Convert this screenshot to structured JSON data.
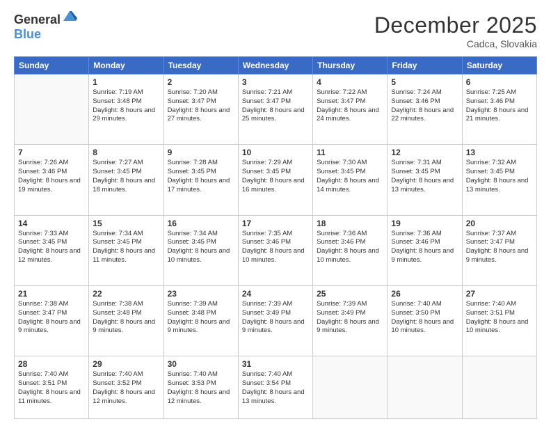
{
  "logo": {
    "general": "General",
    "blue": "Blue"
  },
  "header": {
    "month": "December 2025",
    "location": "Cadca, Slovakia"
  },
  "days": [
    "Sunday",
    "Monday",
    "Tuesday",
    "Wednesday",
    "Thursday",
    "Friday",
    "Saturday"
  ],
  "weeks": [
    [
      {
        "day": "",
        "empty": true
      },
      {
        "day": "1",
        "sunrise": "7:19 AM",
        "sunset": "3:48 PM",
        "daylight": "8 hours and 29 minutes."
      },
      {
        "day": "2",
        "sunrise": "7:20 AM",
        "sunset": "3:47 PM",
        "daylight": "8 hours and 27 minutes."
      },
      {
        "day": "3",
        "sunrise": "7:21 AM",
        "sunset": "3:47 PM",
        "daylight": "8 hours and 25 minutes."
      },
      {
        "day": "4",
        "sunrise": "7:22 AM",
        "sunset": "3:47 PM",
        "daylight": "8 hours and 24 minutes."
      },
      {
        "day": "5",
        "sunrise": "7:24 AM",
        "sunset": "3:46 PM",
        "daylight": "8 hours and 22 minutes."
      },
      {
        "day": "6",
        "sunrise": "7:25 AM",
        "sunset": "3:46 PM",
        "daylight": "8 hours and 21 minutes."
      }
    ],
    [
      {
        "day": "7",
        "sunrise": "7:26 AM",
        "sunset": "3:46 PM",
        "daylight": "8 hours and 19 minutes."
      },
      {
        "day": "8",
        "sunrise": "7:27 AM",
        "sunset": "3:45 PM",
        "daylight": "8 hours and 18 minutes."
      },
      {
        "day": "9",
        "sunrise": "7:28 AM",
        "sunset": "3:45 PM",
        "daylight": "8 hours and 17 minutes."
      },
      {
        "day": "10",
        "sunrise": "7:29 AM",
        "sunset": "3:45 PM",
        "daylight": "8 hours and 16 minutes."
      },
      {
        "day": "11",
        "sunrise": "7:30 AM",
        "sunset": "3:45 PM",
        "daylight": "8 hours and 14 minutes."
      },
      {
        "day": "12",
        "sunrise": "7:31 AM",
        "sunset": "3:45 PM",
        "daylight": "8 hours and 13 minutes."
      },
      {
        "day": "13",
        "sunrise": "7:32 AM",
        "sunset": "3:45 PM",
        "daylight": "8 hours and 13 minutes."
      }
    ],
    [
      {
        "day": "14",
        "sunrise": "7:33 AM",
        "sunset": "3:45 PM",
        "daylight": "8 hours and 12 minutes."
      },
      {
        "day": "15",
        "sunrise": "7:34 AM",
        "sunset": "3:45 PM",
        "daylight": "8 hours and 11 minutes."
      },
      {
        "day": "16",
        "sunrise": "7:34 AM",
        "sunset": "3:45 PM",
        "daylight": "8 hours and 10 minutes."
      },
      {
        "day": "17",
        "sunrise": "7:35 AM",
        "sunset": "3:46 PM",
        "daylight": "8 hours and 10 minutes."
      },
      {
        "day": "18",
        "sunrise": "7:36 AM",
        "sunset": "3:46 PM",
        "daylight": "8 hours and 10 minutes."
      },
      {
        "day": "19",
        "sunrise": "7:36 AM",
        "sunset": "3:46 PM",
        "daylight": "8 hours and 9 minutes."
      },
      {
        "day": "20",
        "sunrise": "7:37 AM",
        "sunset": "3:47 PM",
        "daylight": "8 hours and 9 minutes."
      }
    ],
    [
      {
        "day": "21",
        "sunrise": "7:38 AM",
        "sunset": "3:47 PM",
        "daylight": "8 hours and 9 minutes."
      },
      {
        "day": "22",
        "sunrise": "7:38 AM",
        "sunset": "3:48 PM",
        "daylight": "8 hours and 9 minutes."
      },
      {
        "day": "23",
        "sunrise": "7:39 AM",
        "sunset": "3:48 PM",
        "daylight": "8 hours and 9 minutes."
      },
      {
        "day": "24",
        "sunrise": "7:39 AM",
        "sunset": "3:49 PM",
        "daylight": "8 hours and 9 minutes."
      },
      {
        "day": "25",
        "sunrise": "7:39 AM",
        "sunset": "3:49 PM",
        "daylight": "8 hours and 9 minutes."
      },
      {
        "day": "26",
        "sunrise": "7:40 AM",
        "sunset": "3:50 PM",
        "daylight": "8 hours and 10 minutes."
      },
      {
        "day": "27",
        "sunrise": "7:40 AM",
        "sunset": "3:51 PM",
        "daylight": "8 hours and 10 minutes."
      }
    ],
    [
      {
        "day": "28",
        "sunrise": "7:40 AM",
        "sunset": "3:51 PM",
        "daylight": "8 hours and 11 minutes."
      },
      {
        "day": "29",
        "sunrise": "7:40 AM",
        "sunset": "3:52 PM",
        "daylight": "8 hours and 12 minutes."
      },
      {
        "day": "30",
        "sunrise": "7:40 AM",
        "sunset": "3:53 PM",
        "daylight": "8 hours and 12 minutes."
      },
      {
        "day": "31",
        "sunrise": "7:40 AM",
        "sunset": "3:54 PM",
        "daylight": "8 hours and 13 minutes."
      },
      {
        "day": "",
        "empty": true
      },
      {
        "day": "",
        "empty": true
      },
      {
        "day": "",
        "empty": true
      }
    ]
  ],
  "labels": {
    "sunrise": "Sunrise:",
    "sunset": "Sunset:",
    "daylight": "Daylight:"
  }
}
